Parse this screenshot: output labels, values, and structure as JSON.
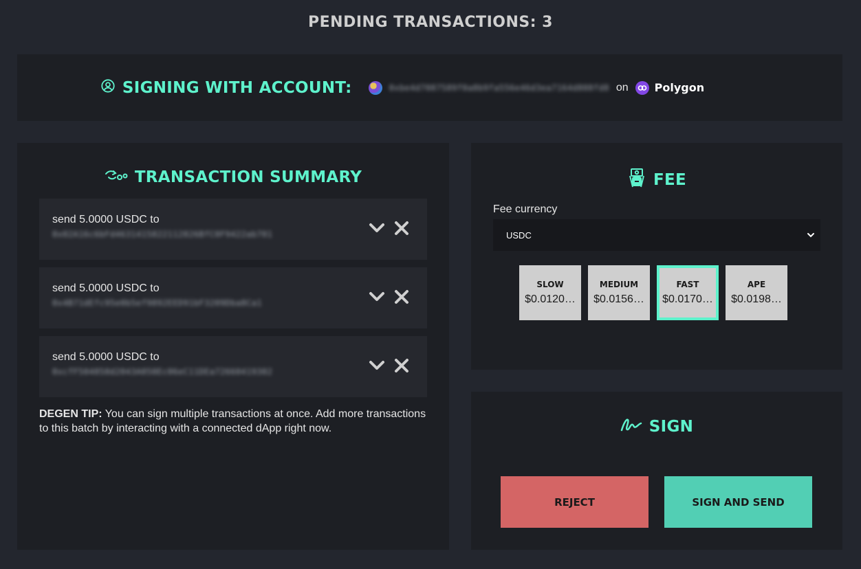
{
  "page": {
    "title": "PENDING TRANSACTIONS: 3"
  },
  "account": {
    "label": "SIGNING WITH ACCOUNT:",
    "address": "0xbe4d7087589f0a8b9fa556e46d3ea7164d808fd8",
    "on_text": "on",
    "chain": "Polygon"
  },
  "summary": {
    "heading": "TRANSACTION SUMMARY",
    "items": [
      {
        "text": "send 5.0000 USDC to",
        "address": "0x02A16c6bFd4631415822112826BfC0F9422ab701"
      },
      {
        "text": "send 5.0000 USDC to",
        "address": "0x4B71dEfc95e0b5ef9892EED91bF3209Dba8Ca1"
      },
      {
        "text": "send 5.0000 USDC to",
        "address": "0xcfF504858d2043A050Ec06eC11DEa72660419302"
      }
    ],
    "tip_label": "DEGEN TIP:",
    "tip_text": " You can sign multiple transactions at once. Add more transactions to this batch by interacting with a connected dApp right now."
  },
  "fee": {
    "heading": "FEE",
    "currency_label": "Fee currency",
    "currency_value": "USDC",
    "options": [
      {
        "name": "SLOW",
        "price": "$0.0120…"
      },
      {
        "name": "MEDIUM",
        "price": "$0.0156…"
      },
      {
        "name": "FAST",
        "price": "$0.0170…"
      },
      {
        "name": "APE",
        "price": "$0.0198…"
      }
    ],
    "selected": "FAST"
  },
  "sign": {
    "heading": "SIGN",
    "reject_label": "REJECT",
    "send_label": "SIGN AND SEND"
  },
  "colors": {
    "background": "#23262e",
    "panel": "#1d1f24",
    "accent": "#5ef2cc",
    "reject": "#d46565",
    "send": "#52cfb4"
  }
}
